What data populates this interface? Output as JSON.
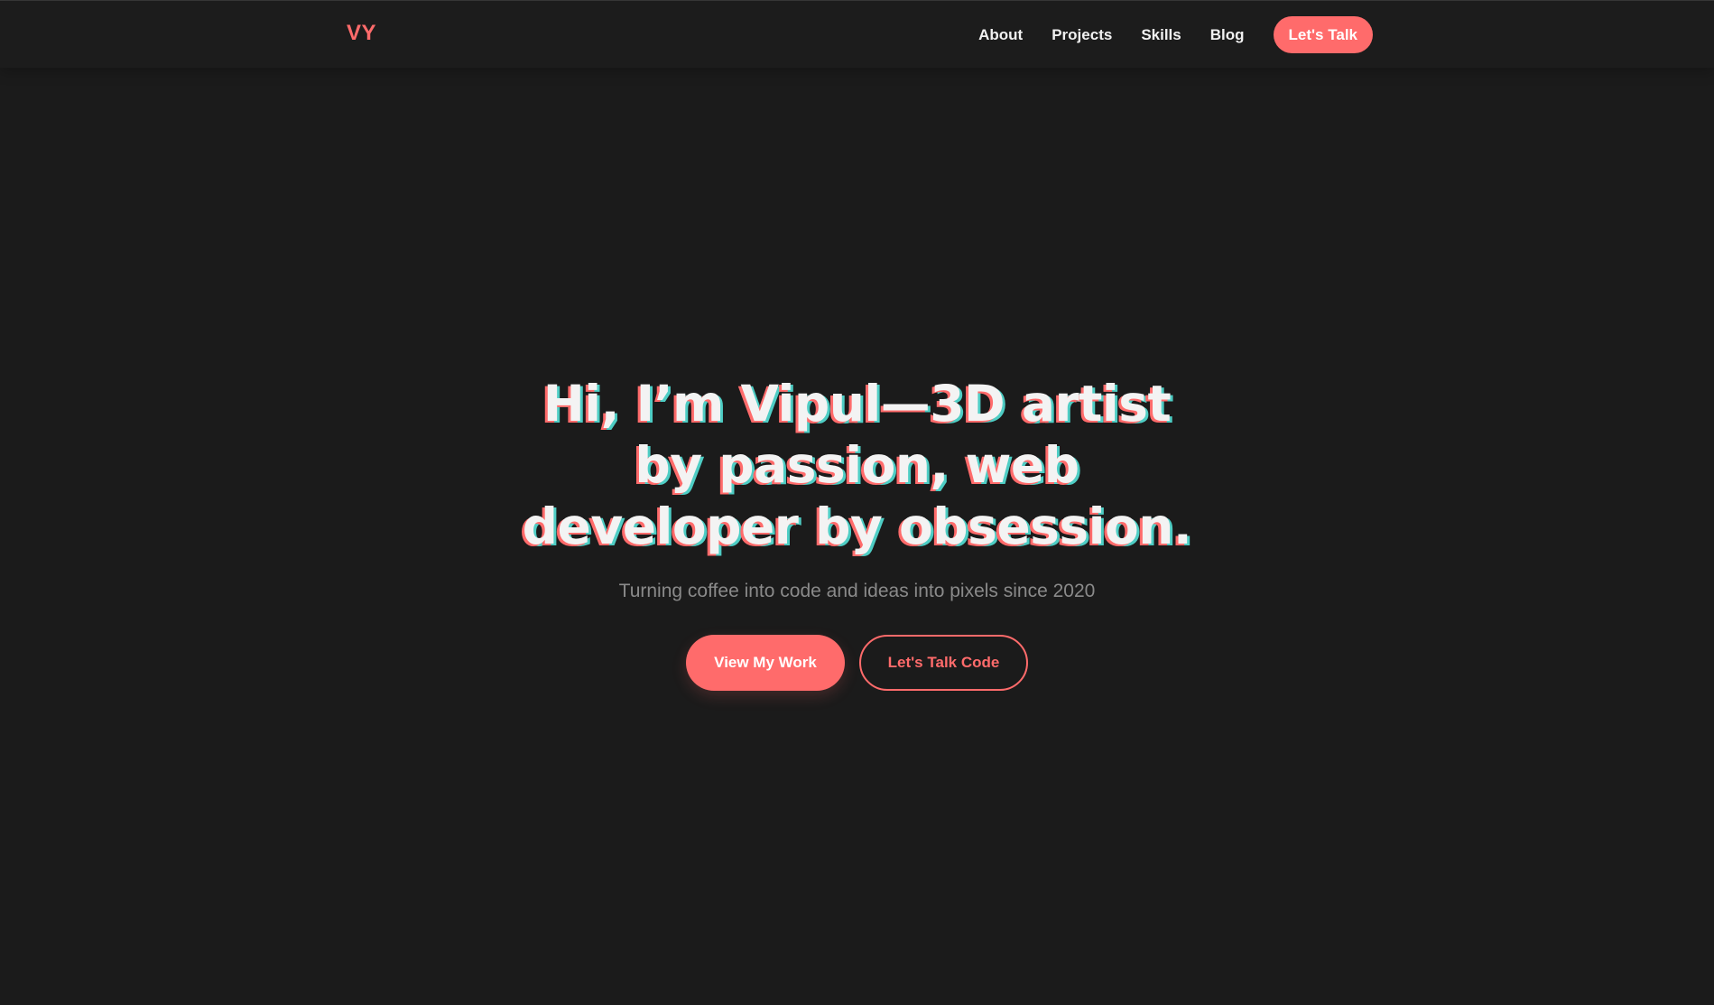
{
  "brand": {
    "logo_text": "VY",
    "accent_color": "#ff6b6b",
    "secondary_color": "#4ecdc4",
    "background_color": "#1b1b1b"
  },
  "nav": {
    "links": [
      {
        "label": "About"
      },
      {
        "label": "Projects"
      },
      {
        "label": "Skills"
      },
      {
        "label": "Blog"
      }
    ],
    "cta_label": "Let's Talk"
  },
  "hero": {
    "title": "Hi, I’m Vipul—3D artist by passion, web developer by obsession.",
    "subtitle": "Turning coffee into code and ideas into pixels since 2020",
    "primary_button": "View My Work",
    "secondary_button": "Let's Talk Code"
  }
}
